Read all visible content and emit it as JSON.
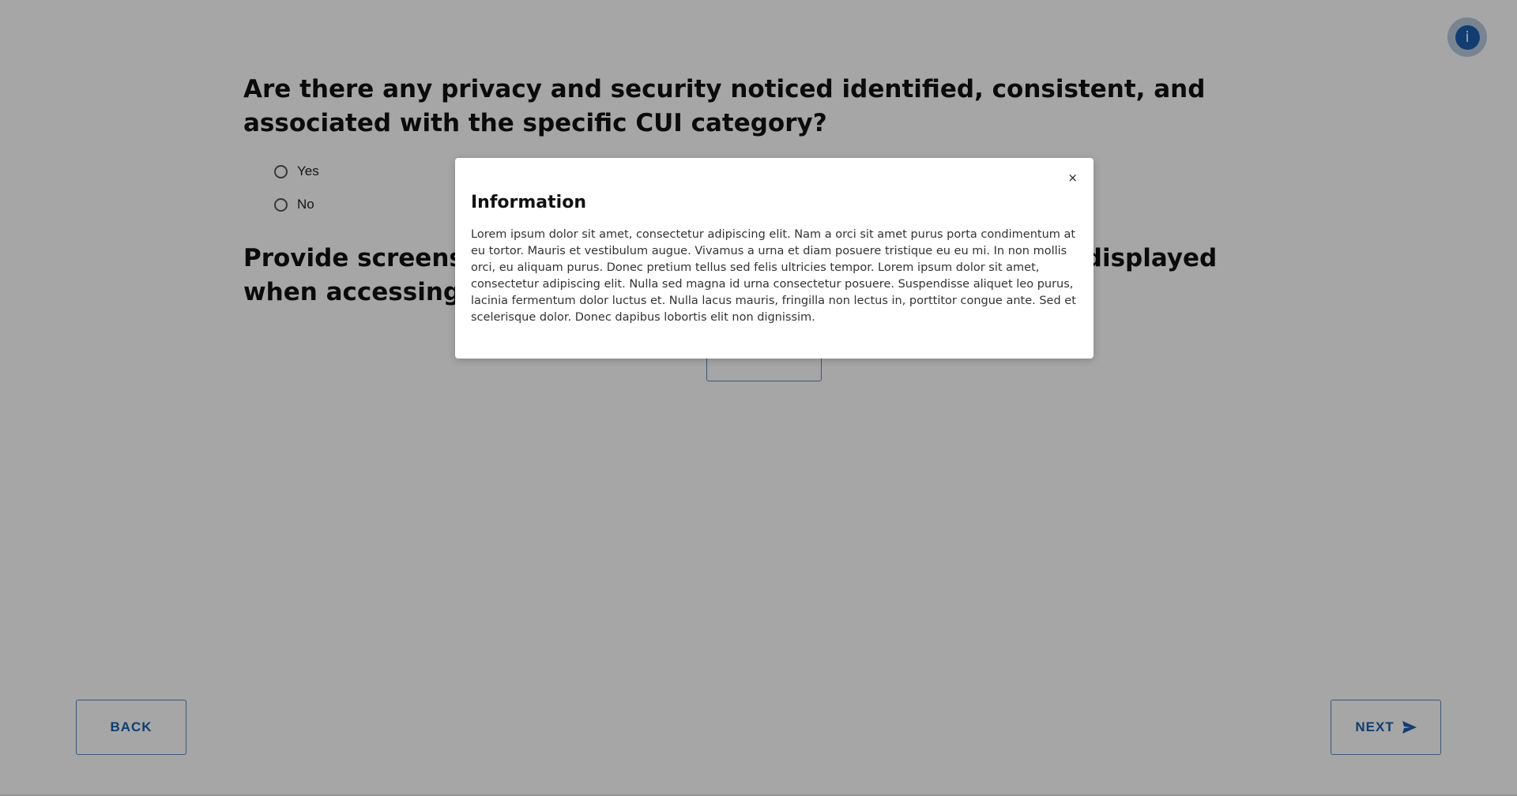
{
  "header": {
    "info_icon": "info-icon",
    "info_glyph": "i"
  },
  "questions": [
    {
      "text": "Are there any privacy and security noticed identified, consistent, and associated with the specific CUI category?",
      "options": [
        {
          "label": "Yes"
        },
        {
          "label": "No"
        }
      ]
    },
    {
      "text": "Provide screenshots of the system use notification message displayed when accessing the system."
    }
  ],
  "navigation": {
    "back_label": "BACK",
    "next_label": "NEXT",
    "next_icon": "send-icon"
  },
  "modal": {
    "title": "Information",
    "close_glyph": "×",
    "body": "Lorem ipsum dolor sit amet, consectetur adipiscing elit. Nam a orci sit amet purus porta condimentum at eu tortor. Mauris et vestibulum augue. Vivamus a urna et diam posuere tristique eu eu mi. In non mollis orci, eu aliquam purus. Donec pretium tellus sed felis ultricies tempor. Lorem ipsum dolor sit amet, consectetur adipiscing elit. Nulla sed magna id urna consectetur posuere. Suspendisse aliquet leo purus, lacinia fermentum dolor luctus et. Nulla lacus mauris, fringilla non lectus in, porttitor congue ante. Sed et scelerisque dolor. Donec dapibus lobortis elit non dignissim."
  },
  "colors": {
    "accent": "#1b5fae",
    "overlay": "rgba(0,0,0,0.35)"
  }
}
